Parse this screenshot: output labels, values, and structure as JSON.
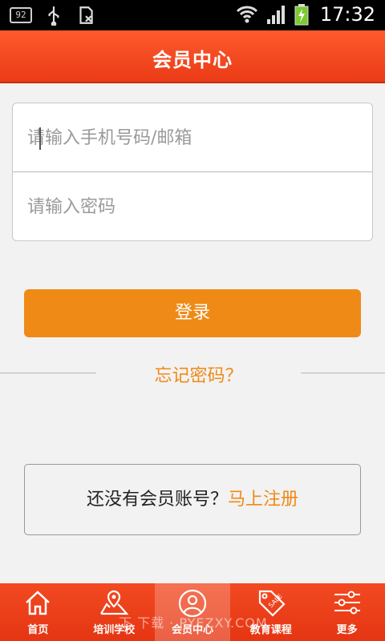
{
  "status_bar": {
    "badge": "92",
    "time": "17:32",
    "icons": [
      "notification-badge-icon",
      "usb-icon",
      "sim-icon",
      "wifi-icon",
      "signal-icon",
      "battery-charging-icon"
    ]
  },
  "header": {
    "title": "会员中心"
  },
  "login_form": {
    "phone_placeholder": "请输入手机号码/邮箱",
    "phone_value": "",
    "password_placeholder": "请输入密码",
    "password_value": "",
    "login_label": "登录",
    "forgot_label": "忘记密码？"
  },
  "register": {
    "question": "还没有会员账号？",
    "link": "马上注册"
  },
  "bottom_nav": {
    "items": [
      {
        "label": "首页",
        "icon": "home-icon"
      },
      {
        "label": "培训学校",
        "icon": "school-map-icon"
      },
      {
        "label": "会员中心",
        "icon": "member-icon",
        "active": true
      },
      {
        "label": "教育课程",
        "icon": "sale-tag-icon"
      },
      {
        "label": "更多",
        "icon": "settings-sliders-icon"
      }
    ]
  },
  "watermark": "下 下载 · PYEZXY.COM",
  "colors": {
    "header": "#ef4520",
    "accent_orange": "#f08a17",
    "background": "#f2f2f2",
    "nav": "#ea3b16"
  }
}
